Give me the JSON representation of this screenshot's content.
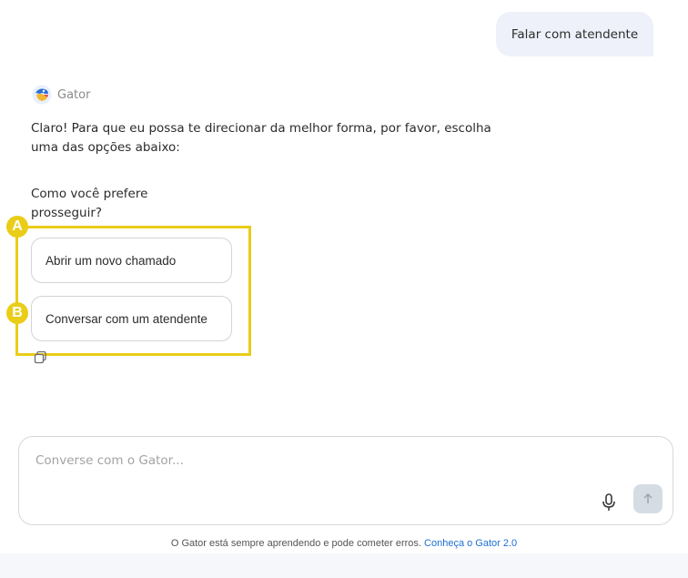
{
  "user_message": "Falar com atendente",
  "bot": {
    "name": "Gator",
    "message": "Claro! Para que eu possa te direcionar da melhor forma, por favor, escolha uma das opções abaixo:",
    "prompt": "Como você prefere prosseguir?",
    "options": [
      {
        "label": "Abrir um novo chamado",
        "marker": "A"
      },
      {
        "label": "Conversar com um atendente",
        "marker": "B"
      }
    ]
  },
  "composer": {
    "placeholder": "Converse com o Gator..."
  },
  "footer": {
    "disclaimer": "O Gator está sempre aprendendo e pode cometer erros.",
    "link": "Conheça o Gator 2.0"
  },
  "colors": {
    "highlight": "#e9cd18",
    "user_bubble": "#eef1fa",
    "link": "#1c6fd1",
    "send_button": "#d6dce4"
  },
  "icons": [
    "gator-avatar-icon",
    "copy-icon",
    "microphone-icon",
    "arrow-up-icon"
  ]
}
